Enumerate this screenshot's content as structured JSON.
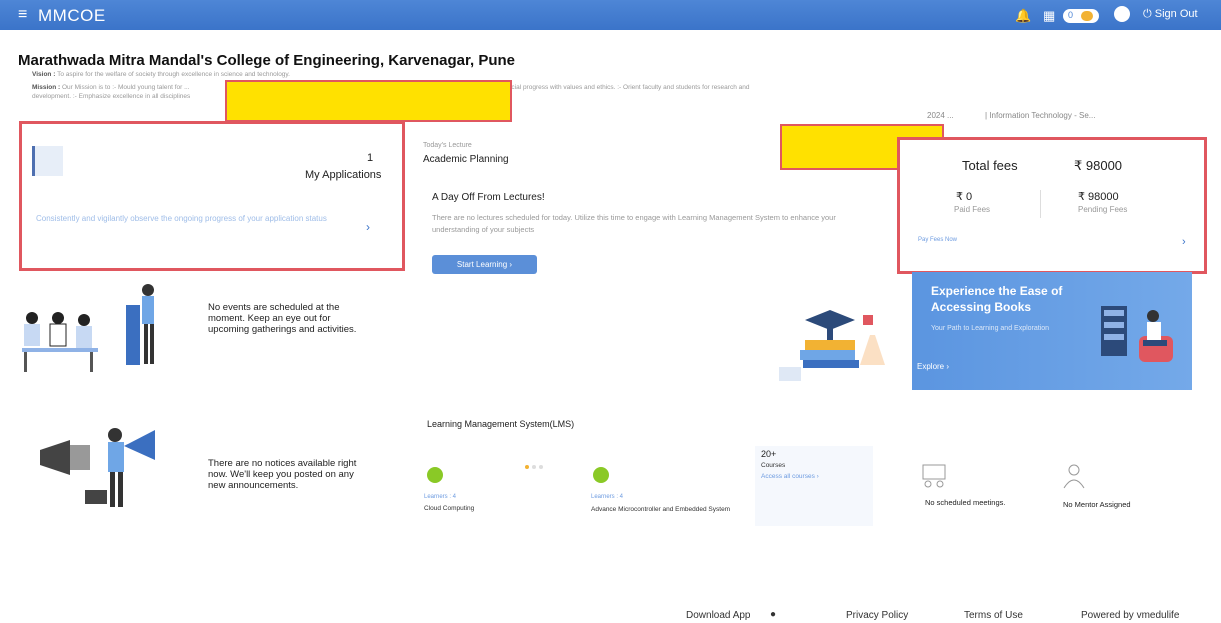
{
  "topbar": {
    "menu_icon": "≡",
    "brand": "MMCOE",
    "coins": "0",
    "sign_out": "Sign Out"
  },
  "header": {
    "college_name": "Marathwada Mitra Mandal's College of Engineering, Karvenagar, Pune",
    "vision_label": "Vision :",
    "vision_text": "To aspire for the welfare of society through excellence in science and technology.",
    "mission_label": "Mission :",
    "mission_text": "Our Mission is to :- Mould young talent for ...",
    "mission_text2": "social progress with values and ethics. :- Orient faculty and students for research and",
    "mission_line2": "development. :- Emphasize excellence in all disciplines",
    "year": "2024 ...",
    "department": "| Information Technology - Se..."
  },
  "applications": {
    "count": "1",
    "label": "My Applications",
    "description": "Consistently and vigilantly observe the ongoing progress of your application status"
  },
  "lecture": {
    "today_label": "Today's Lecture",
    "today_value": "Academic Planning",
    "day_off_title": "A Day Off From Lectures!",
    "day_off_desc": "There are no lectures scheduled for today. Utilize this time to engage with Learning Management System to enhance your understanding of your subjects",
    "start_button": "Start Learning  ›"
  },
  "fees": {
    "title": "Total fees",
    "total": "₹ 98000",
    "paid_amount": "₹ 0",
    "paid_label": "Paid Fees",
    "pending_amount": "₹ 98000",
    "pending_label": "Pending Fees",
    "pay_link": "Pay Fees Now"
  },
  "events": {
    "empty_text": "No events are scheduled at the moment. Keep an eye out for upcoming gatherings and activities."
  },
  "books": {
    "title": "Experience the Ease of Accessing Books",
    "subtitle": "Your Path to Learning and Exploration",
    "explore": "Explore  ›"
  },
  "notices": {
    "empty_text": "There are no notices available right now. We'll keep you posted on any new announcements."
  },
  "lms": {
    "title": "Learning Management System(LMS)",
    "course1_label": "Learners : 4",
    "course1_name": "Cloud Computing",
    "course2_label": "Learners : 4",
    "course2_name": "Advance Microcontroller and Embedded System",
    "courses_count": "20+",
    "courses_label": "Courses",
    "courses_link": "Access all courses  ›"
  },
  "meetings": {
    "empty_text": "No scheduled meetings."
  },
  "mentor": {
    "empty_text": "No Mentor Assigned"
  },
  "footer": {
    "download": "Download App",
    "privacy": "Privacy Policy",
    "terms": "Terms of Use",
    "powered": "Powered by vmedulife"
  },
  "colors": {
    "topbar": "#3b74c9",
    "highlight_border": "#e0575f",
    "redaction": "#ffe100",
    "link": "#6d9be0"
  }
}
